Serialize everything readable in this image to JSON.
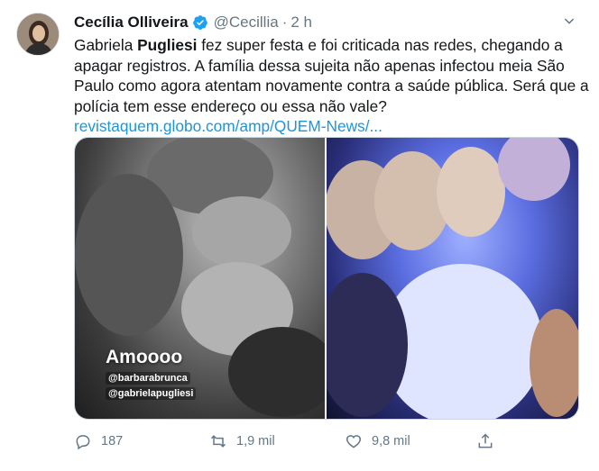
{
  "tweet": {
    "author_name": "Cecília Olliveira",
    "handle": "@Cecillia",
    "separator": "·",
    "time": "2 h",
    "text_lines": [
      {
        "before": "Gabriela ",
        "bold": "Pugliesi",
        "after": " fez super festa e foi criticada nas redes, chegando a"
      },
      {
        "text": "apagar registros. A família dessa sujeita não apenas infectou meia São"
      },
      {
        "text": "Paulo como agora atentam novamente contra a saúde pública. Será que a"
      },
      {
        "text": "polícia tem esse endereço ou essa não vale?"
      }
    ],
    "link_text": "revistaquem.globo.com/amp/QUEM-News/...",
    "media": {
      "left_overlay_title": "Amoooo",
      "left_overlay_tags": [
        "@barbarabrunca",
        "@gabrielapugliesi"
      ]
    },
    "actions": {
      "replies": "187",
      "retweets": "1,9 mil",
      "likes": "9,8 mil"
    }
  },
  "colors": {
    "link": "#1b95e0",
    "secondary_text": "#657786",
    "verified": "#1da1f2"
  },
  "icons": [
    "verified-badge-icon",
    "chevron-down-icon",
    "reply-icon",
    "retweet-icon",
    "like-icon",
    "share-icon"
  ]
}
